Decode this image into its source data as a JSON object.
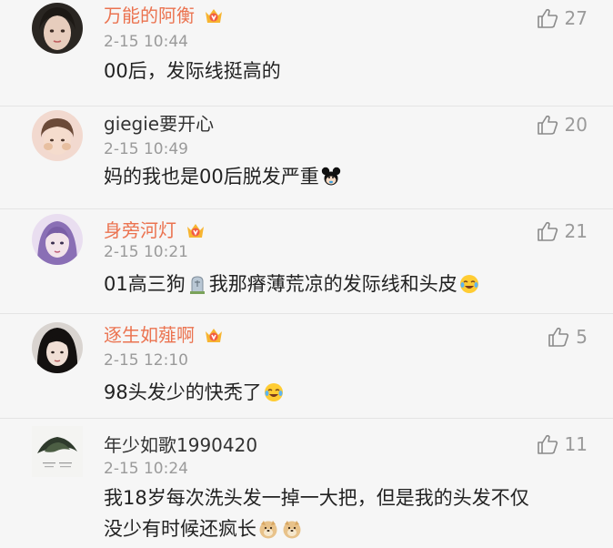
{
  "comments": [
    {
      "username": "万能的阿衡",
      "time": "2-15 10:44",
      "text": "00后，发际线挺高的",
      "likes": "27",
      "vip": true
    },
    {
      "username": "giegie要开心",
      "time": "2-15 10:49",
      "text": "妈的我也是00后脱发严重",
      "likes": "20",
      "vip": false,
      "text_emoji": "mickey-icon"
    },
    {
      "username": "身旁河灯",
      "time": "2-15 10:21",
      "text_part1": "01高三狗",
      "text_part2": "我那瘠薄荒凉的发际线和头皮",
      "likes": "21",
      "vip": true,
      "emojis": [
        "tomb-icon",
        "laugh-cry-icon"
      ]
    },
    {
      "username": "逐生如薤啊",
      "time": "2-15 12:10",
      "text": "98头发少的快秃了",
      "likes": "5",
      "vip": true,
      "text_emoji": "laugh-cry-icon"
    },
    {
      "username": "年少如歌1990420",
      "time": "2-15 10:24",
      "text_line1": "我18岁每次洗头发一掉一大把，但是我的头发不仅",
      "text_line2": "没少有时候还疯长",
      "likes": "11",
      "vip": false,
      "emojis": [
        "doge-icon",
        "doge-icon"
      ]
    }
  ],
  "colors": {
    "background": "#f6f6f6",
    "vip_name": "#eb7350",
    "meta": "#9a9a9a",
    "text": "#222222"
  }
}
